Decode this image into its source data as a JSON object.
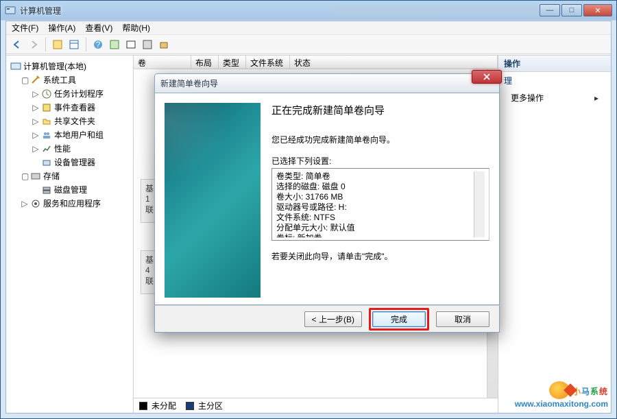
{
  "window": {
    "title": "计算机管理",
    "min": "—",
    "max": "□",
    "close": "✕"
  },
  "menu": {
    "file": "文件(F)",
    "action": "操作(A)",
    "view": "查看(V)",
    "help": "帮助(H)"
  },
  "tree": {
    "root": "计算机管理(本地)",
    "tools": "系统工具",
    "scheduler": "任务计划程序",
    "event": "事件查看器",
    "shared": "共享文件夹",
    "users": "本地用户和组",
    "perf": "性能",
    "devmgr": "设备管理器",
    "storage": "存储",
    "diskmgmt": "磁盘管理",
    "services": "服务和应用程序"
  },
  "columns": {
    "volume": "卷",
    "layout": "布局",
    "type": "类型",
    "fs": "文件系统",
    "status": "状态"
  },
  "legend": {
    "unalloc": "未分配",
    "primary": "主分区"
  },
  "actions": {
    "header": "操作",
    "sub": "理",
    "more": "更多操作"
  },
  "wizard": {
    "title": "新建简单卷向导",
    "heading": "正在完成新建简单卷向导",
    "success": "您已经成功完成新建简单卷向导。",
    "selected": "已选择下列设置:",
    "settings_text": "卷类型: 简单卷\n选择的磁盘: 磁盘 0\n卷大小: 31766 MB\n驱动器号或路径: H:\n文件系统: NTFS\n分配单元大小: 默认值\n卷标: 新加卷\n快速格式化: 是",
    "close_hint": "若要关闭此向导，请单击\"完成\"。",
    "back": "< 上一步(B)",
    "finish": "完成",
    "cancel": "取消"
  },
  "watermark": {
    "t1": "小",
    "t2": "马",
    "t3": "系",
    "t4": "统",
    "url": "www.xiaomaxitong.com"
  },
  "rowblocks": {
    "a1": "基",
    "a2": "1",
    "a3": "联",
    "b1": "基",
    "b2": "4",
    "b3": "联"
  }
}
